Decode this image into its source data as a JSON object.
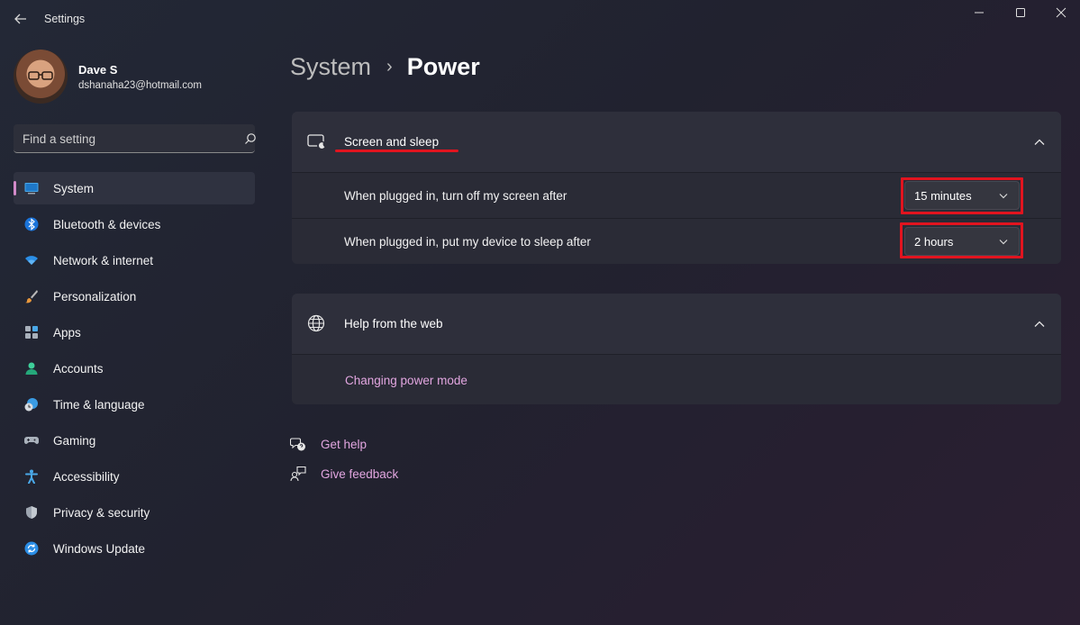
{
  "window": {
    "title": "Settings"
  },
  "profile": {
    "name": "Dave S",
    "email": "dshanaha23@hotmail.com"
  },
  "search": {
    "placeholder": "Find a setting",
    "value": ""
  },
  "nav": {
    "items": [
      {
        "label": "System",
        "icon": "monitor-icon",
        "active": true
      },
      {
        "label": "Bluetooth & devices",
        "icon": "bluetooth-icon"
      },
      {
        "label": "Network & internet",
        "icon": "wifi-icon"
      },
      {
        "label": "Personalization",
        "icon": "brush-icon"
      },
      {
        "label": "Apps",
        "icon": "apps-icon"
      },
      {
        "label": "Accounts",
        "icon": "person-icon"
      },
      {
        "label": "Time & language",
        "icon": "clock-globe-icon"
      },
      {
        "label": "Gaming",
        "icon": "gamepad-icon"
      },
      {
        "label": "Accessibility",
        "icon": "accessibility-icon"
      },
      {
        "label": "Privacy & security",
        "icon": "shield-icon"
      },
      {
        "label": "Windows Update",
        "icon": "update-icon"
      }
    ]
  },
  "breadcrumb": {
    "parent": "System",
    "separator": "›",
    "current": "Power"
  },
  "screen_sleep": {
    "title": "Screen and sleep",
    "rows": [
      {
        "label": "When plugged in, turn off my screen after",
        "value": "15 minutes"
      },
      {
        "label": "When plugged in, put my device to sleep after",
        "value": "2 hours"
      }
    ]
  },
  "help_web": {
    "title": "Help from the web",
    "link": "Changing power mode"
  },
  "footer_links": {
    "get_help": "Get help",
    "give_feedback": "Give feedback"
  },
  "colors": {
    "accent": "#d28ac9",
    "link": "#e2a6e0",
    "annotation": "#e1141f"
  }
}
